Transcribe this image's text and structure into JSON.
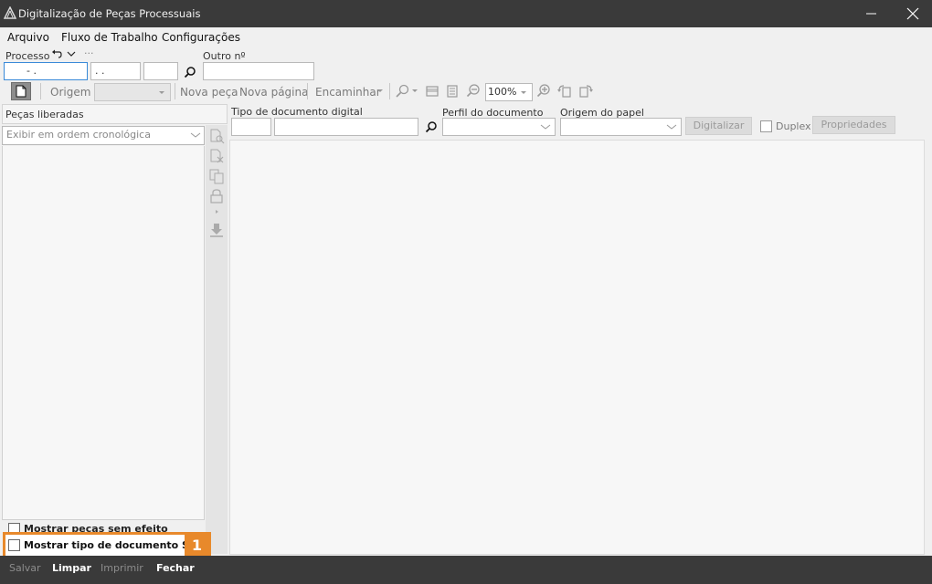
{
  "window": {
    "title": "Digitalização de Peças Processuais"
  },
  "menu": {
    "arquivo": "Arquivo",
    "fluxo": "Fluxo de Trabalho",
    "configuracoes": "Configurações"
  },
  "search": {
    "processo_label": "Processo",
    "outro_label": "Outro nº",
    "processo_part1": "- .",
    "processo_part2": ". .",
    "processo_part3": "",
    "outro_value": "",
    "more": "···"
  },
  "toolbar": {
    "origem_label": "Origem",
    "nova_peca": "Nova peça",
    "nova_pagina": "Nova página",
    "encaminhar": "Encaminhar",
    "zoom": "100%"
  },
  "left_panel": {
    "header": "Peças liberadas",
    "order_select": "Exibir em ordem cronológica",
    "show_no_effect": "Mostrar peças sem efeito",
    "show_saj_type": "Mostrar tipo de documento SAJ"
  },
  "doc_form": {
    "tipo_label": "Tipo de documento digital",
    "perfil_label": "Perfil do documento",
    "origem_papel_label": "Origem do papel",
    "digitalizar": "Digitalizar",
    "duplex": "Duplex",
    "propriedades": "Propriedades"
  },
  "footer": {
    "salvar": "Salvar",
    "limpar": "Limpar",
    "imprimir": "Imprimir",
    "fechar": "Fechar"
  },
  "annotation": {
    "badge": "1"
  },
  "colors": {
    "titlebar": "#3a3a3a",
    "highlight": "#e8892b"
  }
}
